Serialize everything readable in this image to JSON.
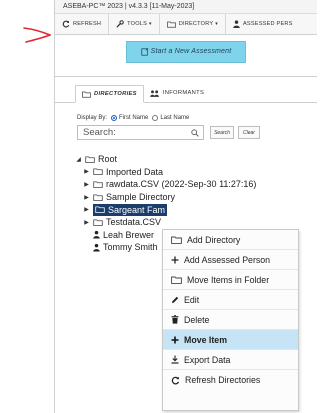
{
  "app": {
    "title": "ASEBA-PC™ 2023 | v4.3.3 [11-May-2023]"
  },
  "toolbar": {
    "refresh_label": "REFRESH",
    "tools_label": "TOOLS",
    "directory_label": "DIRECTORY",
    "assessed_label": "ASSESSED PERS"
  },
  "new_assessment": {
    "label": "Start a New Assessment"
  },
  "tabs": [
    {
      "label": "DIRECTORIES",
      "active": true
    },
    {
      "label": "INFORMANTS",
      "active": false
    }
  ],
  "display_by": {
    "label": "Display By:",
    "options": [
      {
        "label": "First Name",
        "selected": true
      },
      {
        "label": "Last Name",
        "selected": false
      }
    ]
  },
  "search": {
    "placeholder": "Search:",
    "search_button": "Search",
    "clear_button": "Clear"
  },
  "tree": {
    "root": "Root",
    "items": [
      {
        "label": "Imported Data",
        "type": "folder"
      },
      {
        "label": "rawdata.CSV (2022-Sep-30 11:27:16)",
        "type": "folder"
      },
      {
        "label": "Sample Directory",
        "type": "folder"
      },
      {
        "label": "Sargeant Fam",
        "type": "folder",
        "selected": true
      },
      {
        "label": "Testdata.CSV",
        "type": "folder"
      },
      {
        "label": "Leah Brewer",
        "type": "person"
      },
      {
        "label": "Tommy Smith",
        "type": "person"
      }
    ]
  },
  "context_menu": {
    "items": [
      {
        "label": "Add Directory",
        "icon": "folder-icon"
      },
      {
        "label": "Add Assessed Person",
        "icon": "plus-icon"
      },
      {
        "label": "Move Items in Folder",
        "icon": "folder-icon"
      },
      {
        "label": "Edit",
        "icon": "pencil-icon"
      },
      {
        "label": "Delete",
        "icon": "trash-icon"
      },
      {
        "label": "Move Item",
        "icon": "plus-icon",
        "highlighted": true
      },
      {
        "label": "Export Data",
        "icon": "download-icon"
      },
      {
        "label": "Refresh Directories",
        "icon": "refresh-icon"
      }
    ]
  },
  "colors": {
    "accent_button": "#7fd3ea",
    "selection": "#1a3d6b",
    "menu_highlight": "#c6e4f5",
    "annotation_arrow": "#e0282e"
  }
}
